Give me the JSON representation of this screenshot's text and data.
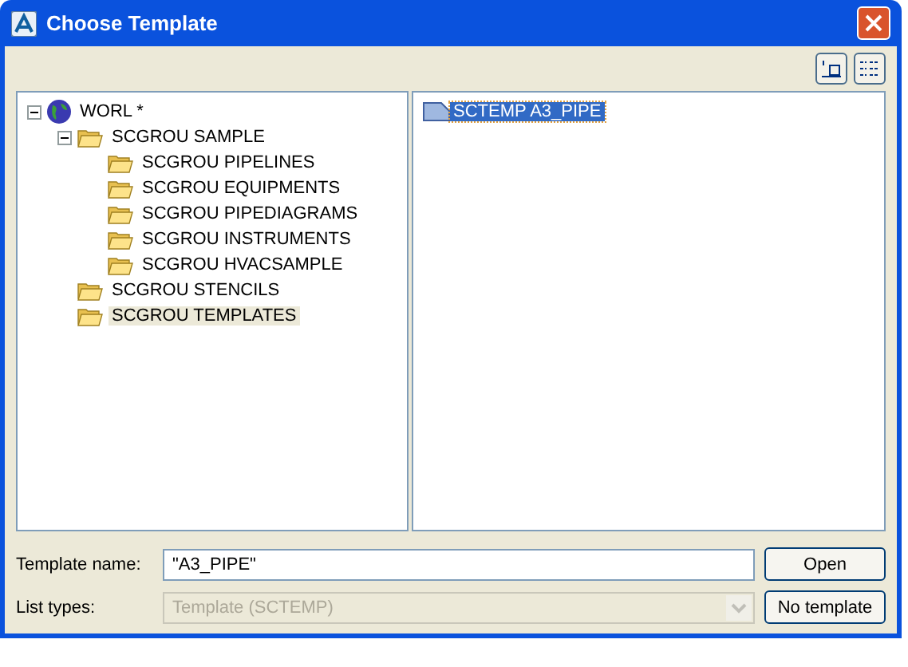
{
  "window": {
    "title": "Choose Template"
  },
  "tree": [
    {
      "label": "WORL *",
      "kind": "globe",
      "expanded": true,
      "selected": false,
      "children": [
        {
          "label": "SCGROU SAMPLE",
          "kind": "folder",
          "expanded": true,
          "selected": false,
          "children": [
            {
              "label": "SCGROU PIPELINES",
              "kind": "folder",
              "selected": false
            },
            {
              "label": "SCGROU EQUIPMENTS",
              "kind": "folder",
              "selected": false
            },
            {
              "label": "SCGROU PIPEDIAGRAMS",
              "kind": "folder",
              "selected": false
            },
            {
              "label": "SCGROU INSTRUMENTS",
              "kind": "folder",
              "selected": false
            },
            {
              "label": "SCGROU HVACSAMPLE",
              "kind": "folder",
              "selected": false
            }
          ]
        },
        {
          "label": "SCGROU STENCILS",
          "kind": "folder",
          "selected": false
        },
        {
          "label": "SCGROU TEMPLATES",
          "kind": "folder",
          "selected": true
        }
      ]
    }
  ],
  "files": [
    {
      "label": "SCTEMP A3_PIPE",
      "selected": true
    }
  ],
  "template_name": {
    "label": "Template name:",
    "value": "\"A3_PIPE\""
  },
  "list_types": {
    "label": "List types:",
    "value": "Template  (SCTEMP)",
    "disabled": true
  },
  "buttons": [
    "Open",
    "No template"
  ]
}
